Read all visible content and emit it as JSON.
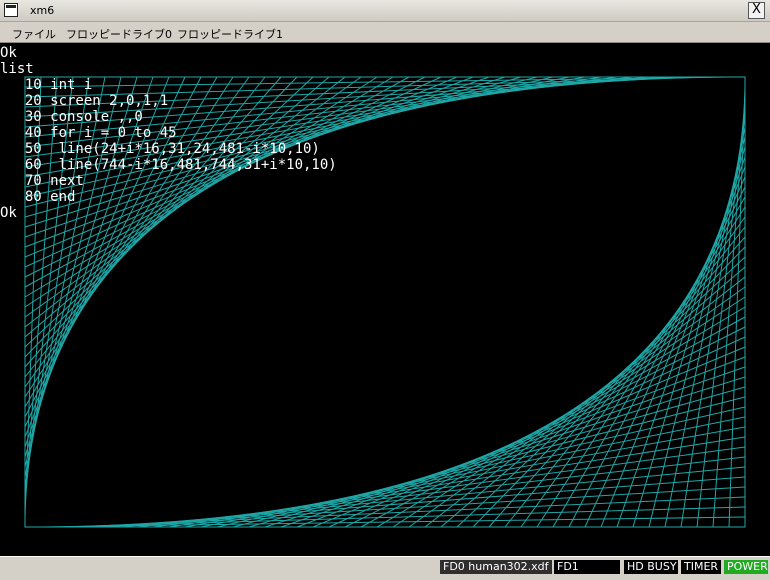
{
  "window": {
    "title": "xm6",
    "close_glyph": "X"
  },
  "menu": {
    "items": [
      "ファイル",
      "フロッピードライブ0",
      "フロッピードライブ1"
    ]
  },
  "terminal": {
    "lines": [
      "Ok",
      "list",
      "  10 int i",
      "  20 screen 2,0,1,1",
      "  30 console ,,0",
      "  40 for i = 0 to 45",
      "  50  line(24+i*16,31,24,481-i*10,10)",
      "  60  line(744-i*16,481,744,31+i*10,10)",
      "  70 next",
      "  80 end",
      "Ok"
    ],
    "graphic_color": "#1fa7a7",
    "text_color": "#ffffff"
  },
  "status": {
    "fd0": "FD0 human302.xdf",
    "fd1": "FD1",
    "hd_busy": "HD BUSY",
    "timer": "TIMER",
    "power": "POWER",
    "power_color": "#22aa22"
  }
}
